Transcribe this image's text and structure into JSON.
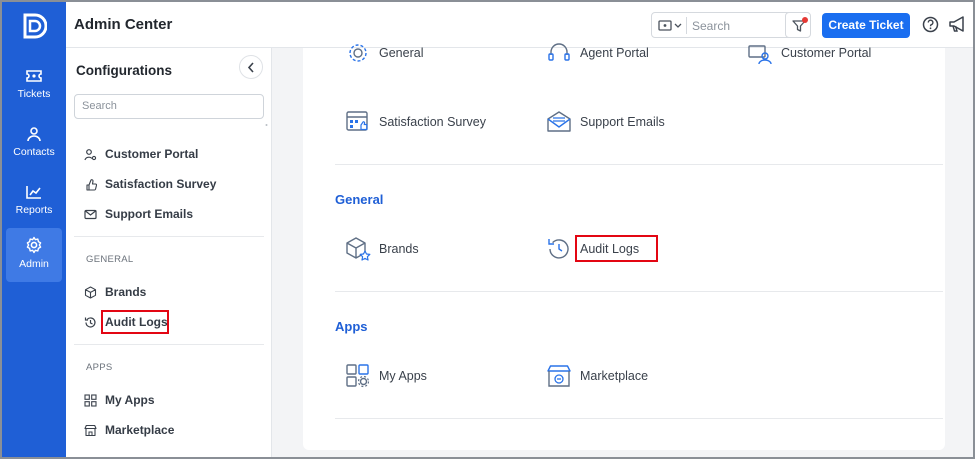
{
  "app": {
    "title": "Admin Center"
  },
  "rail": {
    "items": [
      {
        "label": "Tickets",
        "icon": "ticket-icon"
      },
      {
        "label": "Contacts",
        "icon": "person-icon"
      },
      {
        "label": "Reports",
        "icon": "chart-icon"
      },
      {
        "label": "Admin",
        "icon": "gear-icon",
        "active": true
      }
    ]
  },
  "header": {
    "search_placeholder": "Search",
    "create_button": "Create Ticket"
  },
  "sidebar": {
    "title": "Configurations",
    "search_placeholder": "Search",
    "items": [
      {
        "label": "Customer Portal",
        "icon": "customer-portal-icon"
      },
      {
        "label": "Satisfaction Survey",
        "icon": "survey-icon"
      },
      {
        "label": "Support Emails",
        "icon": "mail-icon"
      }
    ],
    "sections": [
      {
        "label": "GENERAL",
        "items": [
          {
            "label": "Brands",
            "icon": "cube-icon"
          },
          {
            "label": "Audit Logs",
            "icon": "history-icon",
            "highlighted": true
          }
        ]
      },
      {
        "label": "APPS",
        "items": [
          {
            "label": "My Apps",
            "icon": "apps-grid-icon"
          },
          {
            "label": "Marketplace",
            "icon": "store-icon"
          }
        ]
      }
    ]
  },
  "main": {
    "top_tiles": [
      {
        "label": "General",
        "icon": "gear-icon"
      },
      {
        "label": "Agent Portal",
        "icon": "headset-icon"
      },
      {
        "label": "Customer Portal",
        "icon": "customer-portal-icon"
      },
      {
        "label": "Satisfaction Survey",
        "icon": "survey-icon"
      },
      {
        "label": "Support Emails",
        "icon": "mail-icon"
      }
    ],
    "sections": [
      {
        "title": "General",
        "tiles": [
          {
            "label": "Brands",
            "icon": "cube-icon"
          },
          {
            "label": "Audit Logs",
            "icon": "history-icon",
            "highlighted": true
          }
        ]
      },
      {
        "title": "Apps",
        "tiles": [
          {
            "label": "My Apps",
            "icon": "apps-grid-icon"
          },
          {
            "label": "Marketplace",
            "icon": "store-icon"
          }
        ]
      }
    ]
  },
  "colors": {
    "brand": "#1f5fd6",
    "rail_active": "#3f7ae5",
    "highlight": "#e30613",
    "button": "#1a6ef0"
  }
}
